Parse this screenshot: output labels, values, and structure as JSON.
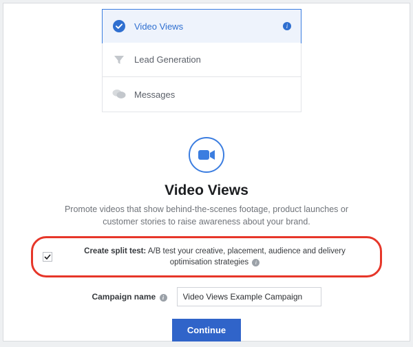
{
  "objectives": [
    {
      "label": "Video Views"
    },
    {
      "label": "Lead Generation"
    },
    {
      "label": "Messages"
    }
  ],
  "detail": {
    "title": "Video Views",
    "subtitle": "Promote videos that show behind-the-scenes footage, product launches or customer stories to raise awareness about your brand."
  },
  "split_test": {
    "bold": "Create split test:",
    "rest": " A/B test your creative, placement, audience and delivery optimisation strategies "
  },
  "campaign_name": {
    "label": "Campaign name",
    "value": "Video Views Example Campaign"
  },
  "continue_label": "Continue"
}
